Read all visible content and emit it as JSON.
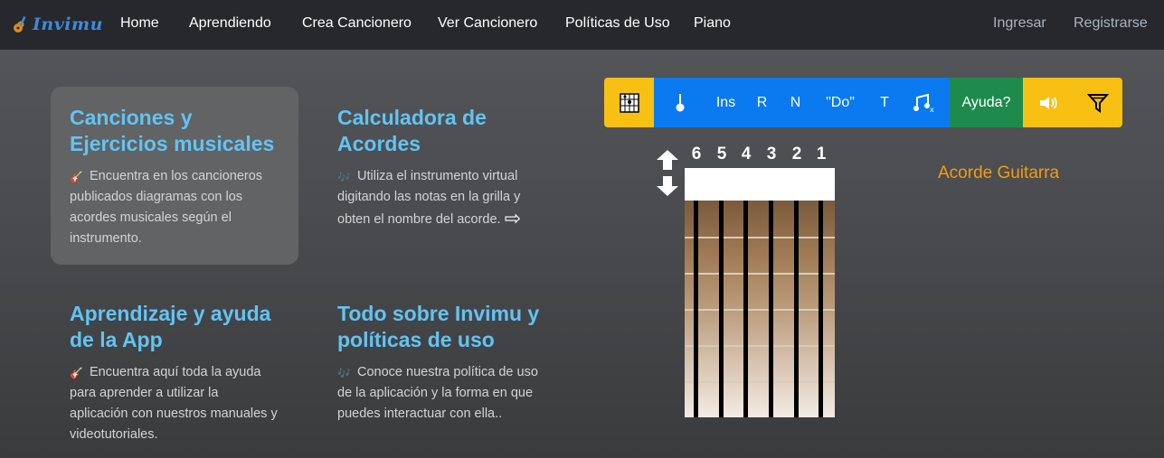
{
  "brand": {
    "name": "Invimu"
  },
  "nav": {
    "items": [
      "Home",
      "Aprendiendo",
      "Crea Cancionero",
      "Ver Cancionero",
      "Políticas de Uso",
      "Piano"
    ],
    "login": "Ingresar",
    "register": "Registrarse"
  },
  "cards": [
    {
      "title": "Canciones y Ejercicios musicales",
      "text": "Encuentra en los cancioneros publicados diagramas con los acordes musicales según el instrumento.",
      "icon": "guitar-icon"
    },
    {
      "title": "Calculadora de Acordes",
      "text": "Utiliza el instrumento virtual digitando las notas en la grilla y obten el nombre del acorde.",
      "icon": "notes-icon"
    },
    {
      "title": "Aprendizaje y ayuda de la App",
      "text": "Encuentra aquí toda la ayuda para aprender a utilizar la aplicación con nuestros manuales y videotutoriales.",
      "icon": "guitar-icon"
    },
    {
      "title": "Todo sobre Invimu y políticas de uso",
      "text": "Conoce nuestra política de uso de la aplicación y la forma en que puedes interactuar con ella..",
      "icon": "notes-icon"
    }
  ],
  "toolbar": {
    "ins": "Ins",
    "r": "R",
    "n": "N",
    "do": "\"Do\"",
    "t": "T",
    "help": "Ayuda?",
    "colors": {
      "yellow": "#f7c012",
      "blue": "#0b7af0",
      "green": "#1e8b4d"
    }
  },
  "fretboard": {
    "strings": [
      "6",
      "5",
      "4",
      "3",
      "2",
      "1"
    ],
    "chord_label": "Acorde Guitarra"
  }
}
